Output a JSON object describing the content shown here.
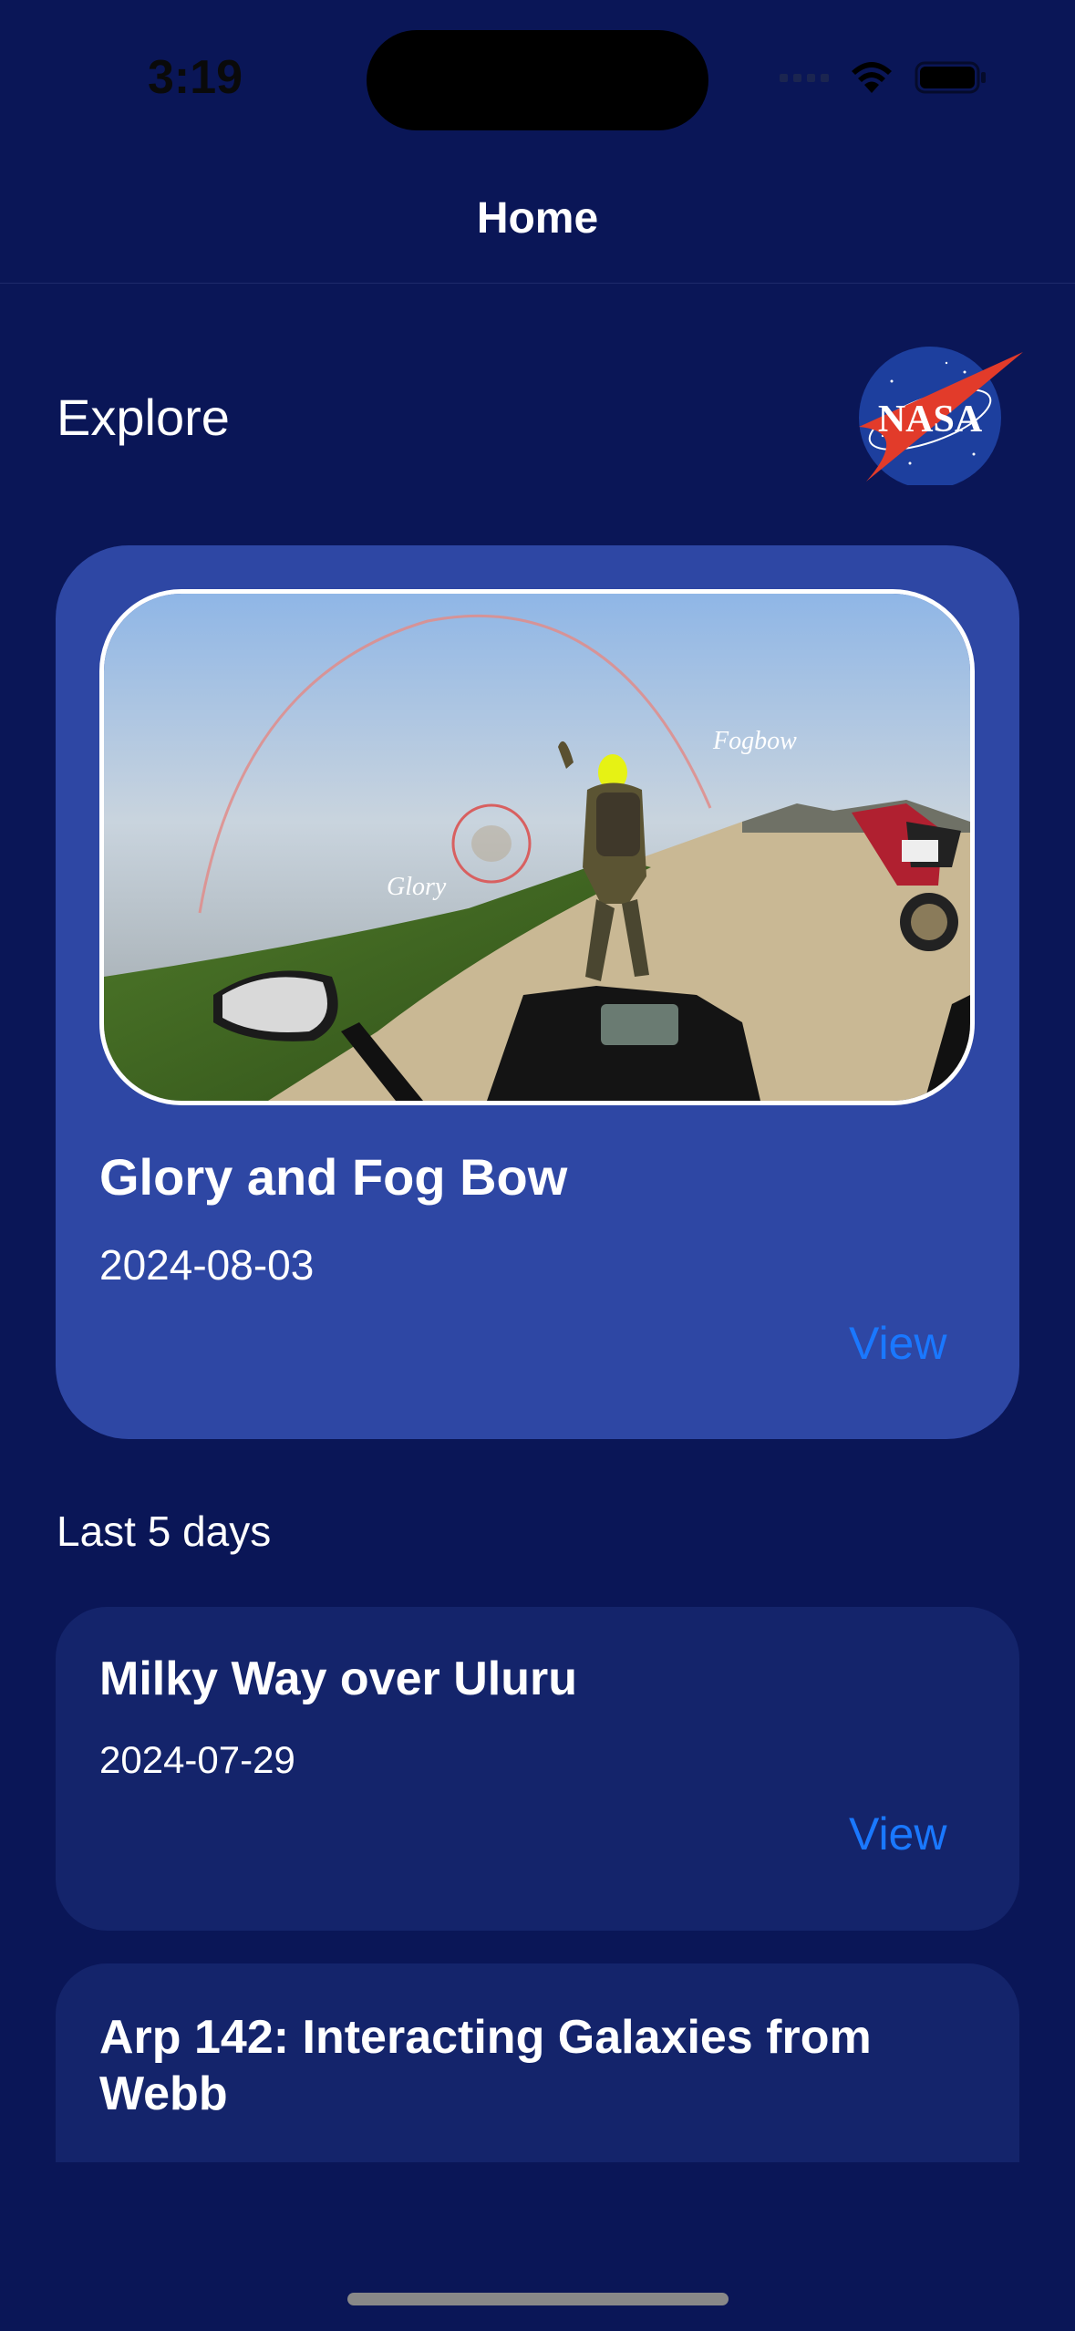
{
  "status": {
    "time": "3:19"
  },
  "nav": {
    "title": "Home"
  },
  "header": {
    "explore_label": "Explore",
    "logo_text": "NASA"
  },
  "featured": {
    "title": "Glory and Fog Bow",
    "date": "2024-08-03",
    "view_label": "View",
    "image_labels": {
      "glory": "Glory",
      "fogbow": "Fogbow"
    }
  },
  "recent": {
    "label": "Last 5 days",
    "items": [
      {
        "title": "Milky Way over Uluru",
        "date": "2024-07-29",
        "view_label": "View"
      },
      {
        "title": "Arp 142: Interacting Galaxies from Webb"
      }
    ]
  },
  "colors": {
    "background": "#0a1657",
    "featured_card": "#2e47a4",
    "card": "#14246b",
    "accent": "#1a78ff"
  }
}
